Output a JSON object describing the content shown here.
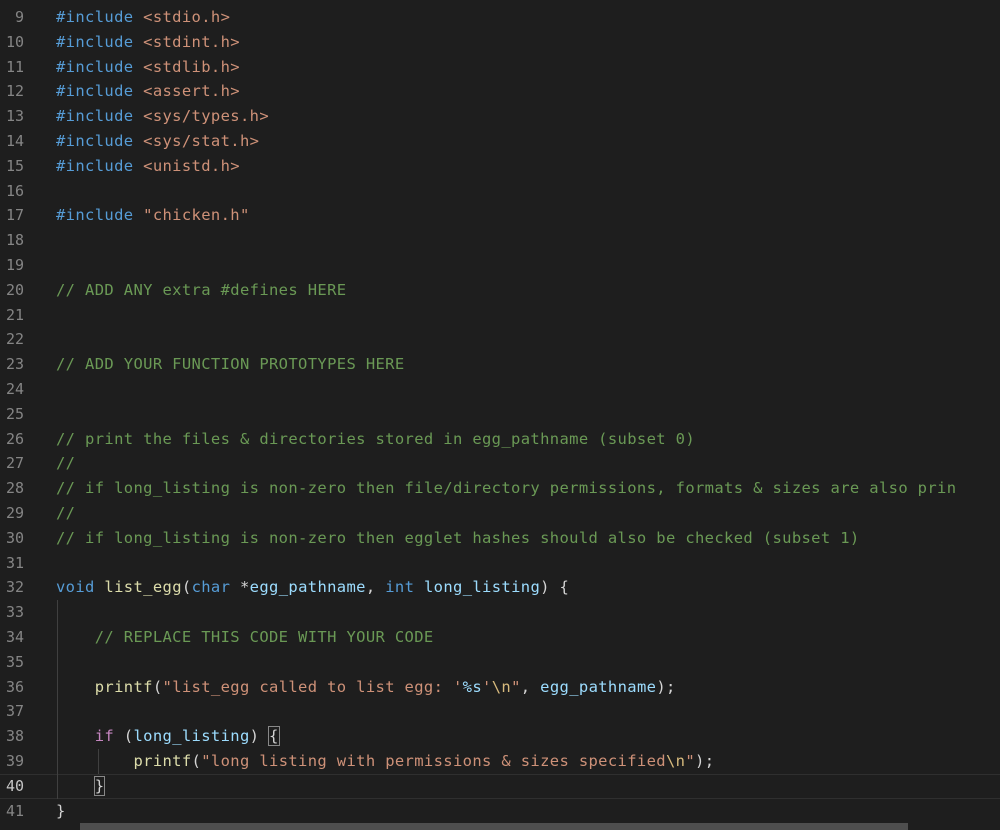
{
  "editor": {
    "lines": [
      {
        "no": "9",
        "indent": 0,
        "tokens": [
          {
            "t": "#include ",
            "c": "#569cd6"
          },
          {
            "t": "<stdio.h>",
            "c": "#ce9178"
          }
        ]
      },
      {
        "no": "10",
        "indent": 0,
        "tokens": [
          {
            "t": "#include ",
            "c": "#569cd6"
          },
          {
            "t": "<stdint.h>",
            "c": "#ce9178"
          }
        ]
      },
      {
        "no": "11",
        "indent": 0,
        "tokens": [
          {
            "t": "#include ",
            "c": "#569cd6"
          },
          {
            "t": "<stdlib.h>",
            "c": "#ce9178"
          }
        ]
      },
      {
        "no": "12",
        "indent": 0,
        "tokens": [
          {
            "t": "#include ",
            "c": "#569cd6"
          },
          {
            "t": "<assert.h>",
            "c": "#ce9178"
          }
        ]
      },
      {
        "no": "13",
        "indent": 0,
        "tokens": [
          {
            "t": "#include ",
            "c": "#569cd6"
          },
          {
            "t": "<sys/types.h>",
            "c": "#ce9178"
          }
        ]
      },
      {
        "no": "14",
        "indent": 0,
        "tokens": [
          {
            "t": "#include ",
            "c": "#569cd6"
          },
          {
            "t": "<sys/stat.h>",
            "c": "#ce9178"
          }
        ]
      },
      {
        "no": "15",
        "indent": 0,
        "tokens": [
          {
            "t": "#include ",
            "c": "#569cd6"
          },
          {
            "t": "<unistd.h>",
            "c": "#ce9178"
          }
        ]
      },
      {
        "no": "16",
        "indent": 0,
        "tokens": []
      },
      {
        "no": "17",
        "indent": 0,
        "tokens": [
          {
            "t": "#include ",
            "c": "#569cd6"
          },
          {
            "t": "\"chicken.h\"",
            "c": "#ce9178"
          }
        ]
      },
      {
        "no": "18",
        "indent": 0,
        "tokens": []
      },
      {
        "no": "19",
        "indent": 0,
        "tokens": []
      },
      {
        "no": "20",
        "indent": 0,
        "tokens": [
          {
            "t": "// ADD ANY extra #defines HERE",
            "c": "#6a9955"
          }
        ]
      },
      {
        "no": "21",
        "indent": 0,
        "tokens": []
      },
      {
        "no": "22",
        "indent": 0,
        "tokens": []
      },
      {
        "no": "23",
        "indent": 0,
        "tokens": [
          {
            "t": "// ADD YOUR FUNCTION PROTOTYPES HERE",
            "c": "#6a9955"
          }
        ]
      },
      {
        "no": "24",
        "indent": 0,
        "tokens": []
      },
      {
        "no": "25",
        "indent": 0,
        "tokens": []
      },
      {
        "no": "26",
        "indent": 0,
        "tokens": [
          {
            "t": "// print the files & directories stored in egg_pathname (subset 0)",
            "c": "#6a9955"
          }
        ]
      },
      {
        "no": "27",
        "indent": 0,
        "tokens": [
          {
            "t": "//",
            "c": "#6a9955"
          }
        ]
      },
      {
        "no": "28",
        "indent": 0,
        "tokens": [
          {
            "t": "// if long_listing is non-zero then file/directory permissions, formats & sizes are also prin",
            "c": "#6a9955"
          }
        ]
      },
      {
        "no": "29",
        "indent": 0,
        "tokens": [
          {
            "t": "//",
            "c": "#6a9955"
          }
        ]
      },
      {
        "no": "30",
        "indent": 0,
        "tokens": [
          {
            "t": "// if long_listing is non-zero then egglet hashes should also be checked (subset 1)",
            "c": "#6a9955"
          }
        ]
      },
      {
        "no": "31",
        "indent": 0,
        "tokens": []
      },
      {
        "no": "32",
        "indent": 0,
        "tokens": [
          {
            "t": "void",
            "c": "#569cd6"
          },
          {
            "t": " list_egg",
            "c": "#dcdcaa"
          },
          {
            "t": "(",
            "c": "#d4d4d4"
          },
          {
            "t": "char",
            "c": "#569cd6"
          },
          {
            "t": " *",
            "c": "#d4d4d4"
          },
          {
            "t": "egg_pathname",
            "c": "#9cdcfe"
          },
          {
            "t": ", ",
            "c": "#d4d4d4"
          },
          {
            "t": "int",
            "c": "#569cd6"
          },
          {
            "t": " long_listing",
            "c": "#9cdcfe"
          },
          {
            "t": ") {",
            "c": "#d4d4d4"
          }
        ]
      },
      {
        "no": "33",
        "indent": 1,
        "tokens": []
      },
      {
        "no": "34",
        "indent": 1,
        "tokens": [
          {
            "t": "    // REPLACE THIS CODE WITH YOUR CODE",
            "c": "#6a9955"
          }
        ]
      },
      {
        "no": "35",
        "indent": 1,
        "tokens": []
      },
      {
        "no": "36",
        "indent": 1,
        "tokens": [
          {
            "t": "    printf",
            "c": "#dcdcaa"
          },
          {
            "t": "(",
            "c": "#d4d4d4"
          },
          {
            "t": "\"list_egg called to list egg: '",
            "c": "#ce9178"
          },
          {
            "t": "%s",
            "c": "#9cdcfe"
          },
          {
            "t": "'",
            "c": "#ce9178"
          },
          {
            "t": "\\n",
            "c": "#d7ba7d"
          },
          {
            "t": "\"",
            "c": "#ce9178"
          },
          {
            "t": ", ",
            "c": "#d4d4d4"
          },
          {
            "t": "egg_pathname",
            "c": "#9cdcfe"
          },
          {
            "t": ");",
            "c": "#d4d4d4"
          }
        ]
      },
      {
        "no": "37",
        "indent": 1,
        "tokens": []
      },
      {
        "no": "38",
        "indent": 1,
        "tokens": [
          {
            "t": "    if",
            "c": "#c586c0"
          },
          {
            "t": " (",
            "c": "#d4d4d4"
          },
          {
            "t": "long_listing",
            "c": "#9cdcfe"
          },
          {
            "t": ") ",
            "c": "#d4d4d4"
          },
          {
            "t": "{",
            "c": "#d4d4d4",
            "box": true
          }
        ]
      },
      {
        "no": "39",
        "indent": 2,
        "tokens": [
          {
            "t": "        printf",
            "c": "#dcdcaa"
          },
          {
            "t": "(",
            "c": "#d4d4d4"
          },
          {
            "t": "\"long listing with permissions & sizes specified",
            "c": "#ce9178"
          },
          {
            "t": "\\n",
            "c": "#d7ba7d"
          },
          {
            "t": "\"",
            "c": "#ce9178"
          },
          {
            "t": ");",
            "c": "#d4d4d4"
          }
        ]
      },
      {
        "no": "40",
        "indent": 1,
        "current": true,
        "tokens": [
          {
            "t": "    ",
            "c": "#d4d4d4"
          },
          {
            "t": "}",
            "c": "#d4d4d4",
            "box": true
          }
        ]
      },
      {
        "no": "41",
        "indent": 0,
        "tokens": [
          {
            "t": "}",
            "c": "#d4d4d4"
          }
        ]
      }
    ]
  }
}
